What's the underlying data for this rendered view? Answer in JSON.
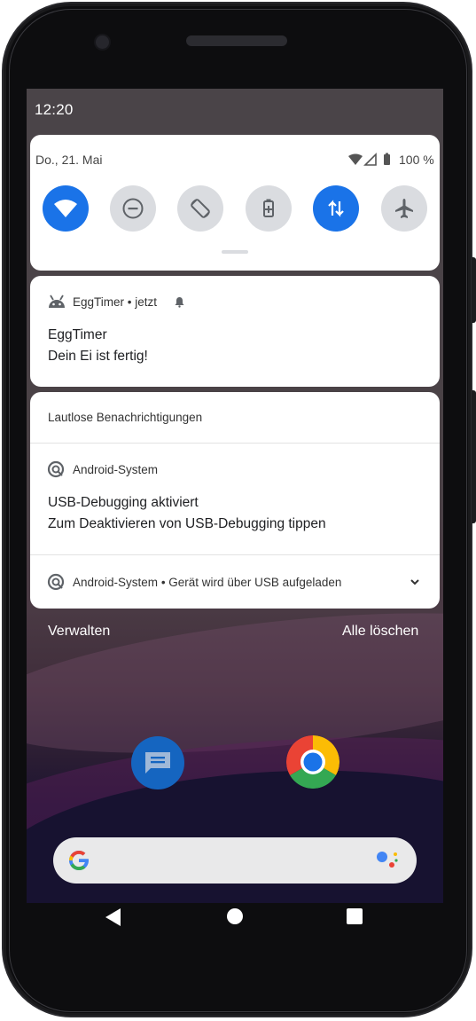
{
  "status_bar": {
    "time": "12:20"
  },
  "quick_settings": {
    "date": "Do., 21. Mai",
    "battery": "100 %",
    "tiles": [
      {
        "icon": "wifi-icon",
        "active": true
      },
      {
        "icon": "do-not-disturb-icon",
        "active": false
      },
      {
        "icon": "auto-rotate-icon",
        "active": false
      },
      {
        "icon": "battery-saver-icon",
        "active": false
      },
      {
        "icon": "mobile-data-icon",
        "active": true
      },
      {
        "icon": "airplane-mode-icon",
        "active": false
      }
    ]
  },
  "notification_alerting": {
    "app": "EggTimer",
    "time": "jetzt",
    "title": "EggTimer",
    "text": "Dein Ei ist fertig!"
  },
  "silent_section": {
    "header": "Lautlose Benachrichtigungen",
    "notifications": [
      {
        "app": "Android-System",
        "title": "USB-Debugging aktiviert",
        "text": "Zum Deaktivieren von USB-Debugging tippen"
      },
      {
        "app": "Android-System",
        "summary": "Gerät wird über USB aufgeladen"
      }
    ]
  },
  "footer": {
    "manage": "Verwalten",
    "clear_all": "Alle löschen"
  },
  "colors": {
    "accent": "#1a73e8",
    "tile_off": "#dadce0",
    "card": "#ffffff"
  }
}
